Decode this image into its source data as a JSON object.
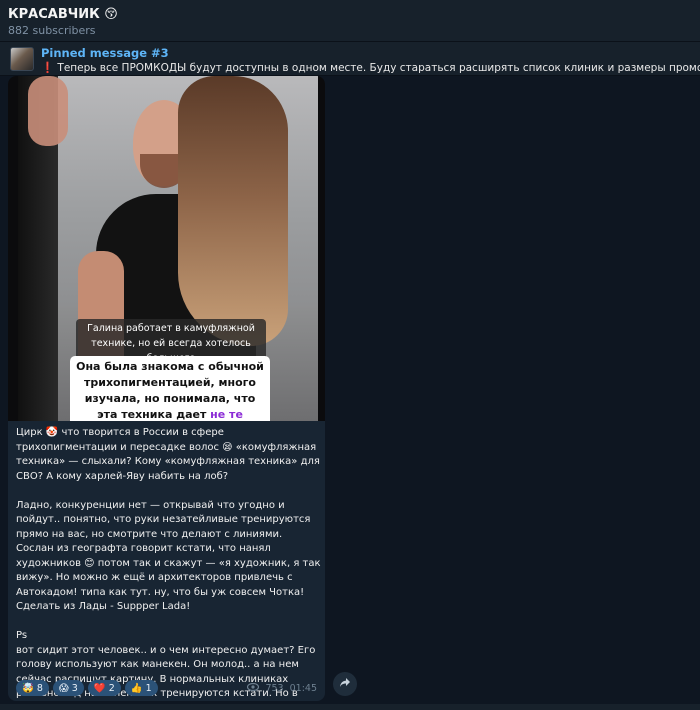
{
  "header": {
    "title": "КРАСАВЧИК 😚",
    "subscribers": "882 subscribers"
  },
  "pinned": {
    "label": "Pinned message #3",
    "text": "❗ Теперь все ПРОМКОДЫ будут доступны в одном месте.    Буду стараться расширять список клиник и размеры промокодов.   ❕ Никогда не"
  },
  "post": {
    "photo_caption_1": "Галина работает в камуфляжной технике, но ей всегда хотелось большего",
    "photo_caption_2_main": "Она была знакома с обычной трихопигментацией, много изучала, но понимала, что эта техника дает ",
    "photo_caption_2_highlight": "не те результаты,",
    "text": "Цирк 🤡 что творится в России в сфере трихопигментации и пересадке волос 😪 «комуфляжная техника» — слыхали? Кому «комуфляжная техника» для СВО? А кому харлей-Яву набить на лоб?\n\nЛадно, конкуренции нет — открывай что угодно и пойдут.. понятно, что руки незатейливые тренируются прямо на вас, но смотрите что делают с линиями. Сослан из географта говорит кстати, что нанял художников 😊 потом так и скажут — «я художник, я так вижу». Но можно ж ещё и архитекторов привлечь с Автокадом! типа как тут. ну, что бы уж совсем Чотка! Сделать из Лады - Suppper Lada!\n\nPs\nвот сидит этот человек.. и о чем интересно думает? Его голову используют как манекен. Он молод.. а на нем сейчас распишут картину. В нормальных клиниках реально год на манекенах тренируются кстати. Но в России можно.. и клиенты не возражают. Я в свою очередь могу только удивится издалека.",
    "reactions": [
      {
        "emoji": "🤯",
        "count": "8"
      },
      {
        "emoji": "😱",
        "count": "3"
      },
      {
        "emoji": "❤️",
        "count": "2"
      },
      {
        "emoji": "👍",
        "count": "1"
      }
    ],
    "views": "753",
    "time": "01:45"
  },
  "icons": {
    "views": "eye-icon",
    "share": "share-arrow-icon"
  }
}
